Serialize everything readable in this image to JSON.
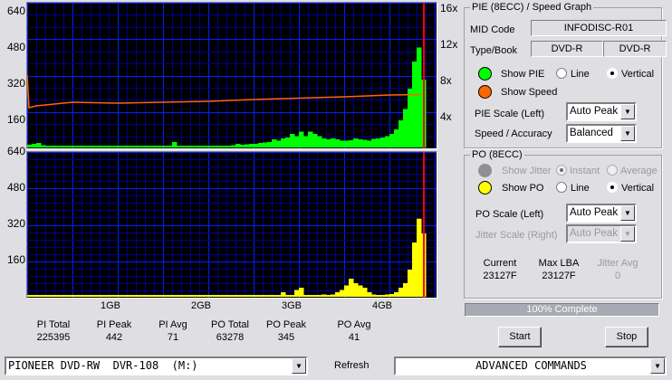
{
  "left_axis_top": [
    "640",
    "480",
    "320",
    "160"
  ],
  "left_axis_bottom": [
    "640",
    "480",
    "320",
    "160"
  ],
  "right_axis": [
    "16x",
    "12x",
    "8x",
    "4x"
  ],
  "x_axis": [
    "1GB",
    "2GB",
    "3GB",
    "4GB"
  ],
  "stats": [
    {
      "label": "PI Total",
      "value": "225395"
    },
    {
      "label": "PI Peak",
      "value": "442"
    },
    {
      "label": "PI Avg",
      "value": "71"
    },
    {
      "label": "PO Total",
      "value": "63278"
    },
    {
      "label": "PO Peak",
      "value": "345"
    },
    {
      "label": "PO Avg",
      "value": "41"
    }
  ],
  "pie_group": {
    "title": "PIE (8ECC) / Speed Graph",
    "mid_label": "MID Code",
    "mid_value": "INFODISC-R01",
    "type_label": "Type/Book",
    "type": "DVD-R",
    "book": "DVD-R",
    "show_pie": "Show PIE",
    "line": "Line",
    "vertical": "Vertical",
    "show_speed": "Show Speed",
    "scale_label": "PIE Scale (Left)",
    "scale_value": "Auto Peak",
    "speed_label": "Speed / Accuracy",
    "speed_value": "Balanced",
    "pie_color": "#00ff00",
    "speed_color": "#ff6600"
  },
  "po_group": {
    "title": "PO (8ECC)",
    "show_jitter": "Show Jitter",
    "instant": "Instant",
    "average": "Average",
    "show_po": "Show PO",
    "line": "Line",
    "vertical": "Vertical",
    "scale_label": "PO Scale (Left)",
    "scale_value": "Auto Peak",
    "jitter_label": "Jitter Scale (Right)",
    "jitter_value": "Auto Peak",
    "current_label": "Current",
    "current_value": "23127F",
    "maxlba_label": "Max LBA",
    "maxlba_value": "23127F",
    "jitter_avg_label": "Jitter Avg",
    "jitter_avg_value": "0",
    "po_color": "#ffff00"
  },
  "progress": {
    "label": "100% Complete",
    "value": 100
  },
  "buttons": {
    "start": "Start",
    "stop": "Stop",
    "refresh": "Refresh"
  },
  "drive": "PIONEER DVD-RW  DVR-108  (M:)",
  "advanced": "ADVANCED COMMANDS",
  "chart_data": [
    {
      "type": "bar",
      "title": "PIE",
      "x_unit": "GB",
      "x_step": 0.05,
      "x_end": 4.38,
      "ylim": [
        0,
        640
      ],
      "y2lim": [
        0,
        16
      ],
      "pie": [
        12,
        16,
        20,
        10,
        8,
        6,
        8,
        6,
        8,
        6,
        4,
        4,
        4,
        4,
        6,
        4,
        4,
        4,
        4,
        6,
        4,
        4,
        4,
        6,
        4,
        4,
        4,
        4,
        4,
        4,
        4,
        4,
        24,
        8,
        6,
        4,
        4,
        4,
        4,
        4,
        4,
        4,
        4,
        4,
        8,
        10,
        16,
        12,
        14,
        16,
        16,
        20,
        22,
        24,
        36,
        30,
        40,
        44,
        60,
        50,
        70,
        50,
        70,
        60,
        50,
        40,
        36,
        40,
        36,
        30,
        30,
        32,
        40,
        36,
        34,
        30,
        38,
        40,
        44,
        50,
        60,
        80,
        120,
        170,
        260,
        380,
        442,
        300
      ],
      "speed": [
        [
          0,
          8.0
        ],
        [
          0.02,
          4.4
        ],
        [
          0.1,
          4.6
        ],
        [
          0.5,
          5.0
        ],
        [
          1.0,
          4.9
        ],
        [
          1.5,
          5.0
        ],
        [
          2.0,
          5.1
        ],
        [
          2.5,
          5.3
        ],
        [
          3.0,
          5.45
        ],
        [
          3.5,
          5.6
        ],
        [
          4.0,
          5.8
        ],
        [
          4.35,
          5.85
        ]
      ]
    },
    {
      "type": "bar",
      "title": "PO",
      "x_unit": "GB",
      "x_step": 0.05,
      "x_end": 4.38,
      "ylim": [
        0,
        640
      ],
      "po": [
        2,
        0,
        0,
        0,
        0,
        0,
        0,
        0,
        0,
        0,
        0,
        0,
        0,
        0,
        0,
        0,
        0,
        0,
        0,
        0,
        0,
        0,
        0,
        0,
        0,
        0,
        0,
        8,
        0,
        0,
        0,
        0,
        0,
        0,
        0,
        0,
        0,
        0,
        0,
        0,
        0,
        0,
        0,
        0,
        0,
        0,
        0,
        0,
        0,
        0,
        0,
        0,
        0,
        0,
        0,
        0,
        20,
        0,
        0,
        30,
        40,
        4,
        2,
        2,
        4,
        10,
        4,
        10,
        20,
        30,
        50,
        80,
        60,
        50,
        40,
        20,
        10,
        8,
        8,
        10,
        12,
        20,
        40,
        60,
        120,
        240,
        345,
        280
      ]
    }
  ]
}
